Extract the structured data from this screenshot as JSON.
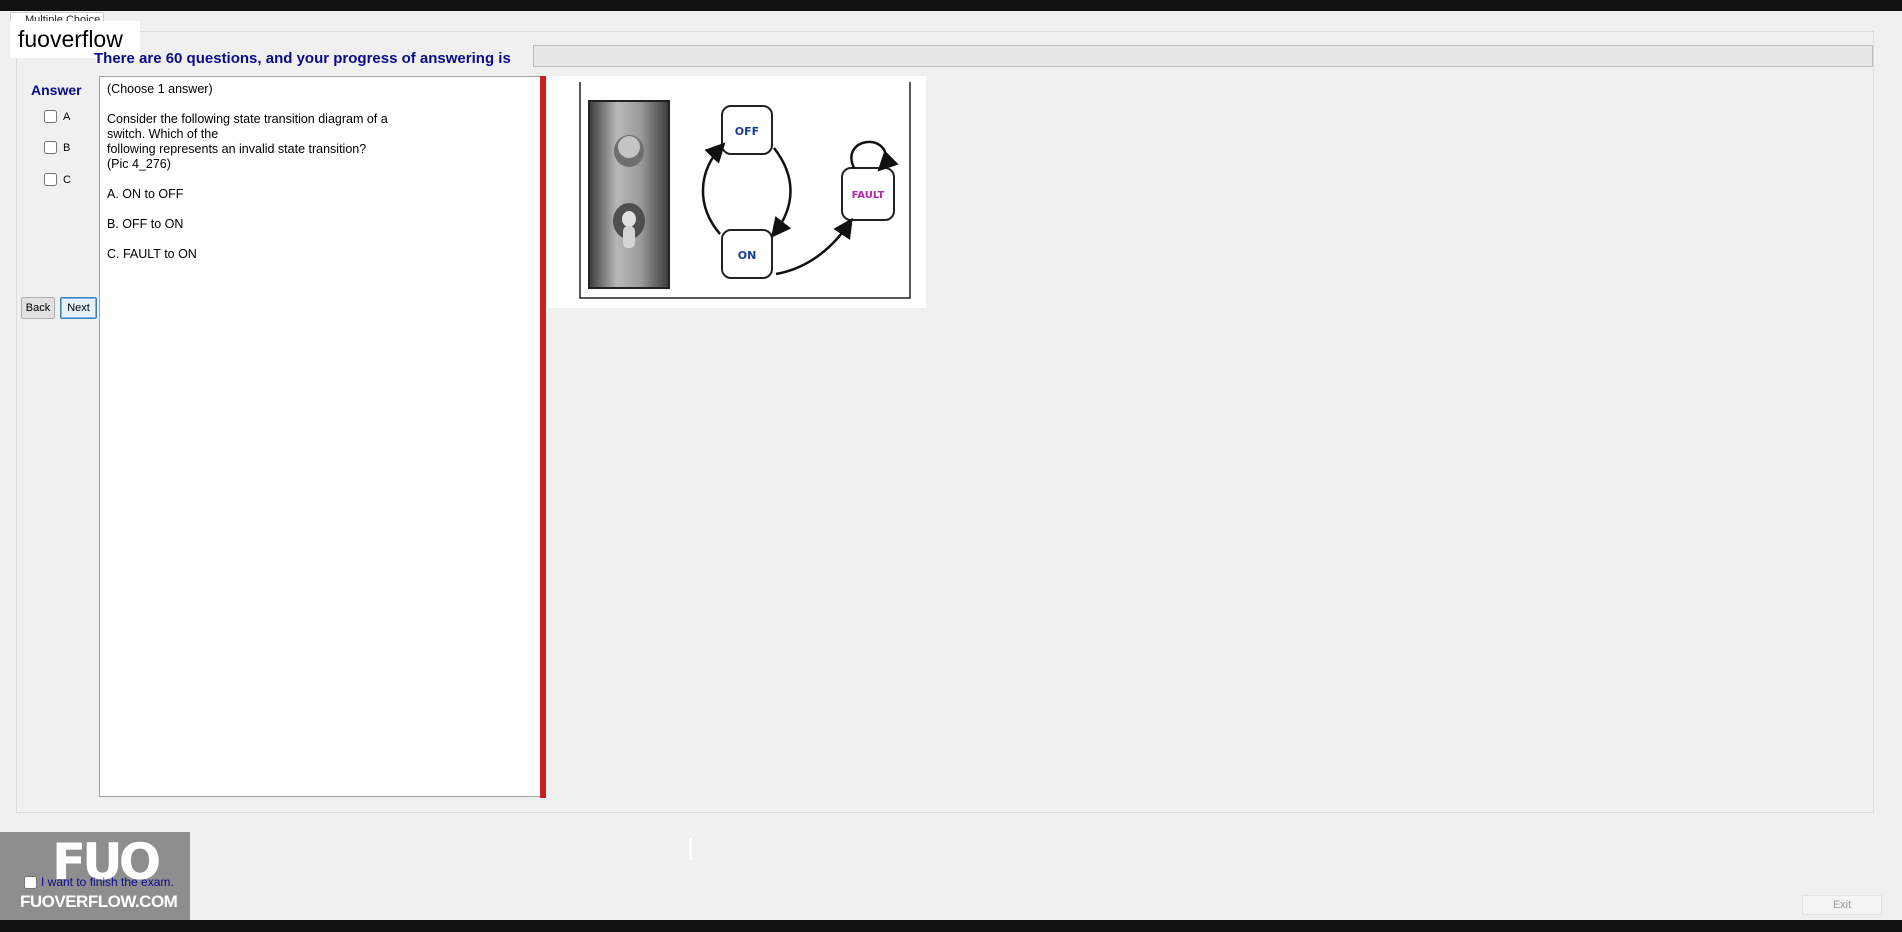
{
  "window": {
    "tab_label": "Multiple Choice",
    "watermark_text": "fuoverflow"
  },
  "progress": {
    "label": "There are 60 questions, and your progress of answering is",
    "value": 0
  },
  "answer": {
    "heading": "Answer",
    "options": [
      "A",
      "B",
      "C"
    ]
  },
  "nav": {
    "back_label": "Back",
    "next_label": "Next"
  },
  "question": {
    "instruction": "(Choose 1 answer)",
    "lines": [
      "Consider the following state transition diagram of a",
      "switch. Which of the",
      "following represents an invalid state transition?",
      "(Pic 4_276)"
    ],
    "answers": [
      "A.  ON to OFF",
      "B.  OFF to ON",
      "C.  FAULT to ON"
    ]
  },
  "diagram": {
    "states": [
      "OFF",
      "ON",
      "FAULT"
    ],
    "colors": {
      "state_text": "#1a3a9c",
      "fault_text": "#b02aa8",
      "splitter": "#c8201c"
    }
  },
  "footer": {
    "finish_label": "I want to finish the exam.",
    "exit_label": "Exit",
    "logo_big": "FUO",
    "logo_small": "FUOVERFLOW.COM"
  }
}
